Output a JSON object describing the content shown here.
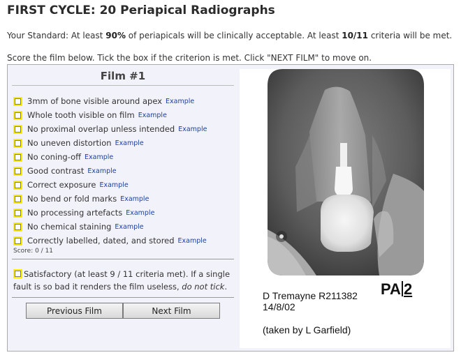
{
  "page": {
    "title": "FIRST CYCLE: 20 Periapical Radiographs",
    "standard_prefix": "Your Standard: At least ",
    "standard_pct": "90%",
    "standard_mid": " of periapicals will be clinically acceptable. At least ",
    "standard_crit": "10/11",
    "standard_suffix": " criteria will be met.",
    "instructions": "Score the film below. Tick the box if the criterion is met. Click \"NEXT FILM\" to move on."
  },
  "film": {
    "title": "Film #1",
    "example_label": "Example",
    "criteria": [
      "3mm of bone visible around apex",
      "Whole tooth visible on film",
      "No proximal overlap unless intended",
      "No uneven distortion",
      "No coning-off",
      "Good contrast",
      "Correct exposure",
      "No bend or fold marks",
      "No processing artefacts",
      "No chemical staining",
      "Correctly labelled, dated, and stored"
    ],
    "score": "Score: 0 / 11",
    "satisfactory_text": "Satisfactory (at least 9 / 11 criteria met). If a single fault is so bad it renders the film useless, ",
    "satisfactory_em": "do not tick",
    "satisfactory_end": "."
  },
  "buttons": {
    "previous": "Previous Film",
    "next": "Next Film"
  },
  "radiograph": {
    "patient_line": "D Tremayne R211382",
    "label_pa": "PA",
    "label_num": "2",
    "date": "14/8/02",
    "taken_by": "(taken by L Garfield)"
  },
  "colors": {
    "checkbox_highlight": "#ffee00",
    "example_link": "#1a3fa8",
    "panel_bg": "#f2f2fa"
  }
}
